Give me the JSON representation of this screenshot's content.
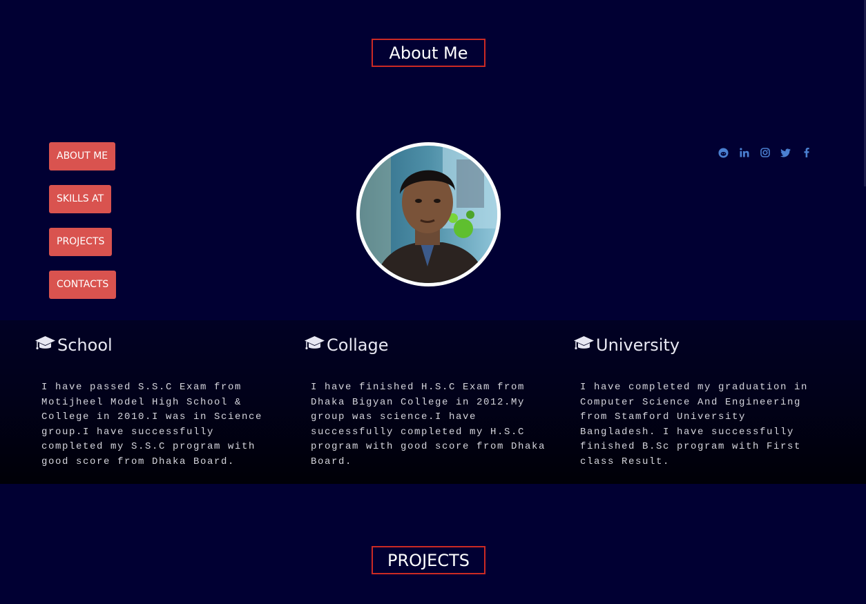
{
  "about_section": {
    "title": "About Me"
  },
  "nav": {
    "items": [
      {
        "label": "ABOUT ME"
      },
      {
        "label": "SKILLS AT"
      },
      {
        "label": "PROJECTS"
      },
      {
        "label": "CONTACTS"
      }
    ]
  },
  "profile": {
    "avatar_alt": "profile photo"
  },
  "socials": [
    "reddit-icon",
    "linkedin-icon",
    "instagram-icon",
    "twitter-icon",
    "facebook-icon"
  ],
  "education": [
    {
      "title": "School",
      "text": "I have passed S.S.C Exam from Motijheel Model High School & College in 2010.I was in Science group.I have successfully completed my S.S.C program with good score from Dhaka Board."
    },
    {
      "title": "Collage",
      "text": "I have finished H.S.C Exam from Dhaka Bigyan College in 2012.My group was science.I have successfully completed my H.S.C program with good score from Dhaka Board."
    },
    {
      "title": "University",
      "text": "I have completed my graduation in Computer Science And Engineering from Stamford University Bangladesh. I have successfully finished B.Sc program with First class Result."
    }
  ],
  "projects_section": {
    "title": "PROJECTS"
  },
  "colors": {
    "background": "#010033",
    "accent": "#d9534f",
    "border": "#cc2a24",
    "social": "#4a7fd0"
  }
}
